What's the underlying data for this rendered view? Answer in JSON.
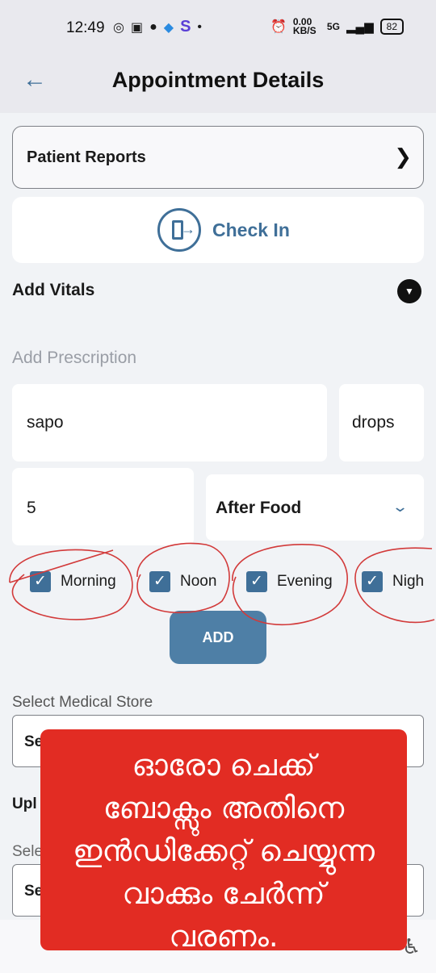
{
  "status_bar": {
    "time": "12:49",
    "left_icons": [
      "whatsapp-icon",
      "chat-icon",
      "facebook-icon",
      "app-icon",
      "s-app-icon",
      "dot-icon"
    ],
    "net_speed": "0.00 KB/S",
    "signal": "5G",
    "battery": "82"
  },
  "app_bar": {
    "title": "Appointment Details",
    "back_icon": "arrow-left-icon"
  },
  "patient_reports": {
    "label": "Patient Reports",
    "icon": "chevron-right-icon"
  },
  "check_in": {
    "label": "Check In",
    "icon": "door-enter-icon"
  },
  "vitals": {
    "label": "Add Vitals",
    "icon": "caret-down-circle-icon"
  },
  "prescription": {
    "title": "Add Prescription",
    "medicine_name": "sapo",
    "unit": "drops",
    "quantity": "5",
    "timing": "After Food",
    "timing_icon": "chevron-down-icon",
    "slots": [
      {
        "label": "Morning",
        "checked": true
      },
      {
        "label": "Noon",
        "checked": true
      },
      {
        "label": "Evening",
        "checked": true
      },
      {
        "label": "Nigh",
        "checked": true
      }
    ],
    "add_label": "ADD"
  },
  "medical_store": {
    "label": "Select Medical Store",
    "value": "Se"
  },
  "upload": {
    "label": "Upl",
    "select_label": "Sele",
    "value": "Se"
  },
  "overlay": {
    "lines": [
      "ഓരോ ചെക്ക്",
      "ബോക്സും അതിനെ",
      "ഇൻഡിക്കേറ്റ് ചെയ്യുന്ന",
      "വാക്കും ചേർന്ന്",
      "വരണം."
    ]
  },
  "colors": {
    "accent": "#3f6f98",
    "button": "#4e7fa6",
    "overlay": "#e22c23",
    "annotation": "#d23a3a"
  }
}
